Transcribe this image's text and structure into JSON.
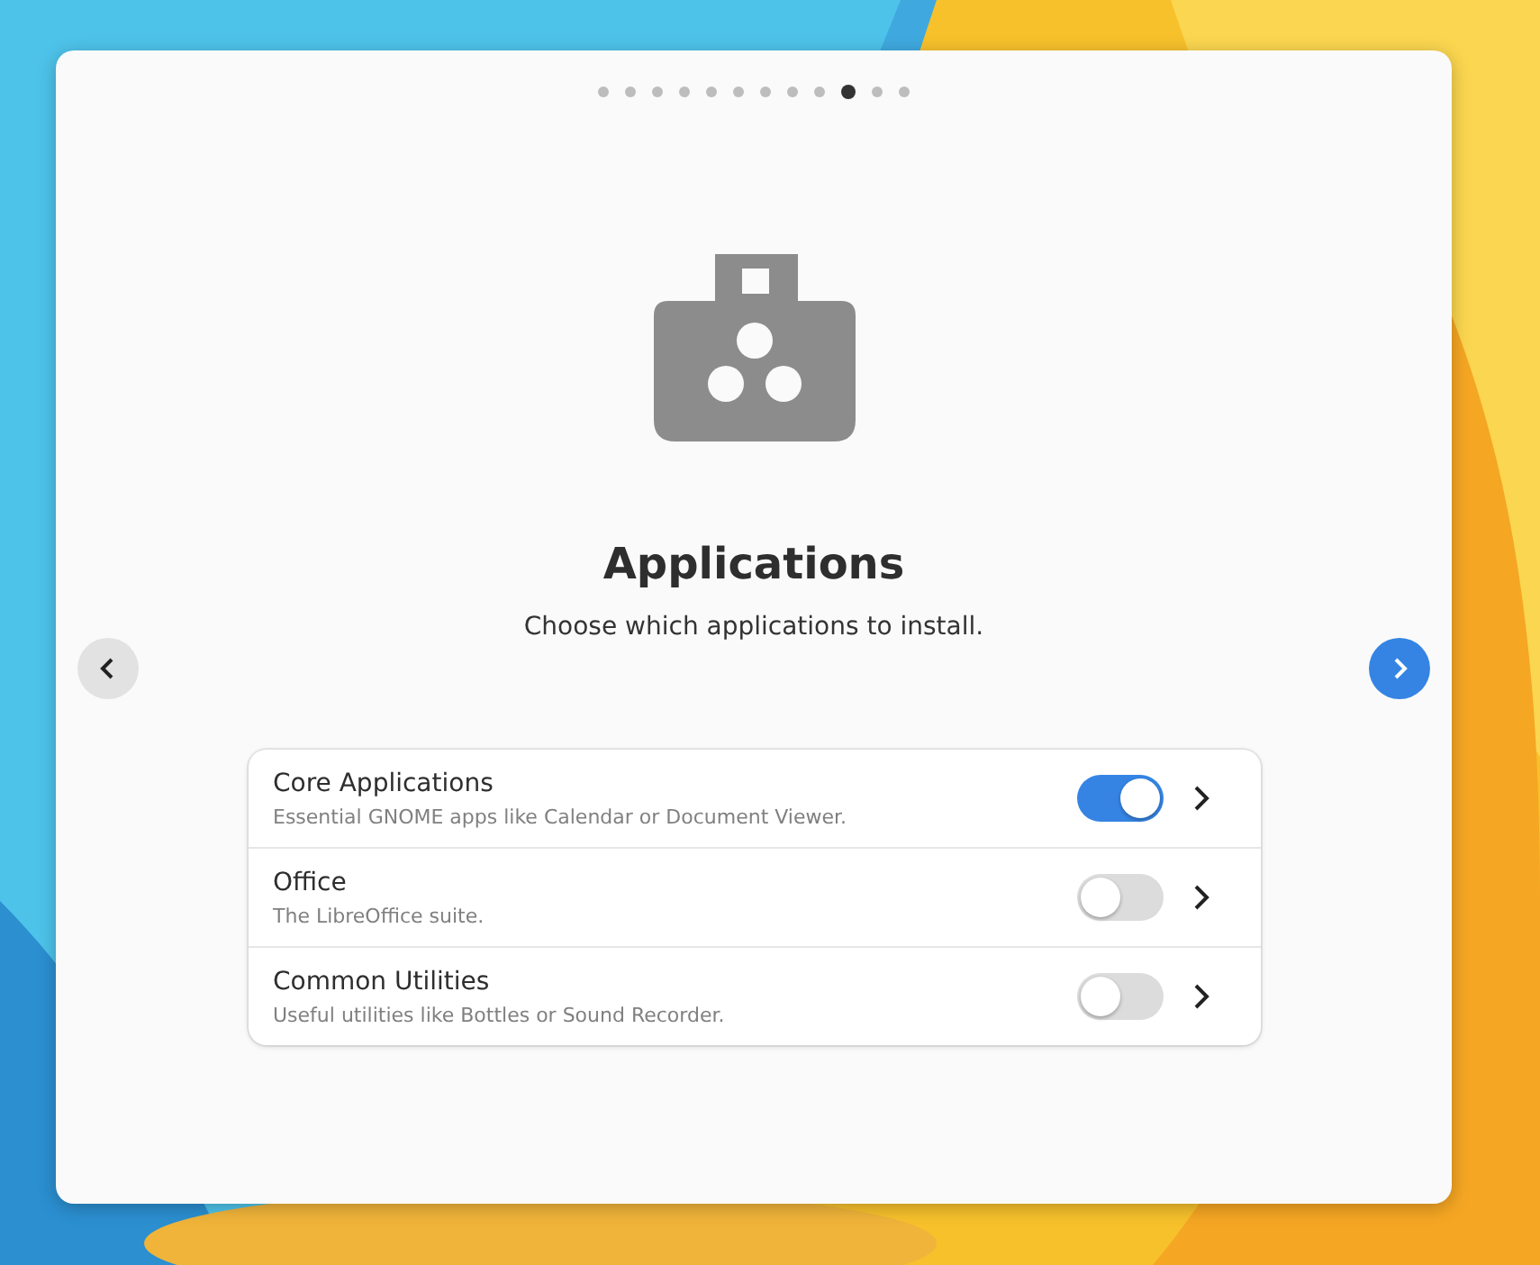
{
  "pages": [
    {
      "selected": false
    },
    {
      "selected": false
    },
    {
      "selected": false
    },
    {
      "selected": false
    },
    {
      "selected": false
    },
    {
      "selected": false
    },
    {
      "selected": false
    },
    {
      "selected": false
    },
    {
      "selected": false
    },
    {
      "selected": true
    },
    {
      "selected": false
    },
    {
      "selected": false
    }
  ],
  "title": "Applications",
  "subtitle": "Choose which applications to install.",
  "options": [
    {
      "name": "Core Applications",
      "description": "Essential GNOME apps like Calendar or Document Viewer.",
      "on": true
    },
    {
      "name": "Office",
      "description": "The LibreOffice suite.",
      "on": false
    },
    {
      "name": "Common Utilities",
      "description": "Useful utilities like Bottles or Sound Recorder.",
      "on": false
    }
  ]
}
